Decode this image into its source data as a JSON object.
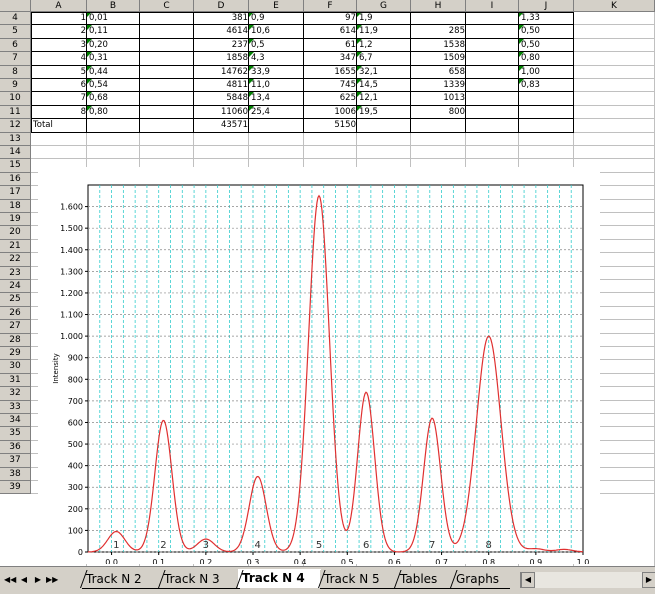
{
  "columns": [
    "A",
    "B",
    "C",
    "D",
    "E",
    "F",
    "G",
    "H",
    "I",
    "J",
    "K"
  ],
  "rows": [
    "4",
    "5",
    "6",
    "7",
    "8",
    "9",
    "10",
    "11",
    "12",
    "13",
    "14",
    "15",
    "16",
    "17",
    "18",
    "19",
    "20",
    "21",
    "22",
    "23",
    "24",
    "25",
    "26",
    "27",
    "28",
    "29",
    "30",
    "31",
    "32",
    "33",
    "34",
    "35",
    "36",
    "37",
    "38",
    "39"
  ],
  "table": {
    "A": [
      "1",
      "2",
      "3",
      "4",
      "5",
      "6",
      "7",
      "8",
      "Total"
    ],
    "B": [
      "0,01",
      "0,11",
      "0,20",
      "0,31",
      "0,44",
      "0,54",
      "0,68",
      "0,80",
      ""
    ],
    "D": [
      "381",
      "4614",
      "237",
      "1858",
      "14762",
      "4811",
      "5848",
      "11060",
      "43571"
    ],
    "E": [
      "0,9",
      "10,6",
      "0,5",
      "4,3",
      "33,9",
      "11,0",
      "13,4",
      "25,4",
      ""
    ],
    "F": [
      "97",
      "614",
      "61",
      "347",
      "1655",
      "745",
      "625",
      "1006",
      "5150"
    ],
    "G": [
      "1,9",
      "11,9",
      "1,2",
      "6,7",
      "32,1",
      "14,5",
      "12,1",
      "19,5",
      ""
    ],
    "H": [
      "",
      "285",
      "1538",
      "1509",
      "658",
      "1339",
      "1013",
      "800",
      ""
    ],
    "J": [
      "1,33",
      "0,50",
      "0,50",
      "0,80",
      "1,00",
      "0,83",
      "",
      ""
    ]
  },
  "chart_data": {
    "type": "line",
    "title": "",
    "xlabel": "",
    "ylabel": "Intensity",
    "xlim": [
      -0.05,
      1.0
    ],
    "ylim": [
      0,
      1700
    ],
    "x_ticks": [
      "0,0",
      "0,1",
      "0,2",
      "0,3",
      "0,4",
      "0,5",
      "0,6",
      "0,7",
      "0,8",
      "0,9",
      "1,0"
    ],
    "x_tick_values": [
      0.0,
      0.1,
      0.2,
      0.3,
      0.4,
      0.5,
      0.6,
      0.7,
      0.8,
      0.9,
      1.0
    ],
    "y_ticks": [
      "0",
      "100",
      "200",
      "300",
      "400",
      "500",
      "600",
      "700",
      "800",
      "900",
      "1.000",
      "1.100",
      "1.200",
      "1.300",
      "1.400",
      "1.500",
      "1.600"
    ],
    "y_tick_values": [
      0,
      100,
      200,
      300,
      400,
      500,
      600,
      700,
      800,
      900,
      1000,
      1100,
      1200,
      1300,
      1400,
      1500,
      1600
    ],
    "peak_labels": [
      "1",
      "2",
      "3",
      "4",
      "5",
      "6",
      "7",
      "8"
    ],
    "peak_positions": [
      0.01,
      0.11,
      0.2,
      0.31,
      0.44,
      0.54,
      0.68,
      0.8
    ],
    "series": [
      {
        "color": "#e03030",
        "peaks": [
          {
            "x": 0.01,
            "y": 95
          },
          {
            "x": 0.11,
            "y": 610
          },
          {
            "x": 0.2,
            "y": 60
          },
          {
            "x": 0.31,
            "y": 350
          },
          {
            "x": 0.44,
            "y": 1650
          },
          {
            "x": 0.54,
            "y": 740
          },
          {
            "x": 0.68,
            "y": 620
          },
          {
            "x": 0.8,
            "y": 1000
          },
          {
            "x": 0.9,
            "y": 15
          },
          {
            "x": 0.96,
            "y": 12
          }
        ]
      }
    ],
    "grid": true
  },
  "sheet_tabs": {
    "nav": [
      "◀◀",
      "◀",
      "▶",
      "▶▶"
    ],
    "tabs": [
      "Track N 2",
      "Track N 3",
      "Track N 4",
      "Track N 5",
      "Tables",
      "Graphs"
    ],
    "active": "Track N 4"
  }
}
